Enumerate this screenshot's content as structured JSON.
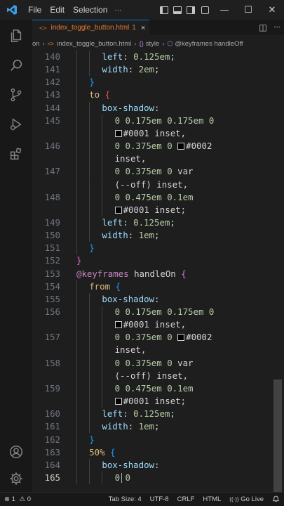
{
  "titlebar": {
    "menu": [
      "File",
      "Edit",
      "Selection"
    ],
    "more": "···",
    "minimize": "—",
    "maximize": "☐",
    "close": "✕"
  },
  "tab": {
    "icon": "<>",
    "label": "index_toggle_button.html",
    "problem_count": "1",
    "close": "×"
  },
  "tab_actions": {
    "split": "◫",
    "more": "···"
  },
  "breadcrumb": {
    "items": [
      "on",
      "index_toggle_button.html",
      "style",
      "@keyframes handleOff"
    ],
    "sep": "›",
    "html_icon": "<>",
    "style_icon": "{}",
    "sym_icon": "⬡"
  },
  "editor": {
    "lines": [
      {
        "n": "140",
        "indent": 2,
        "tokens": [
          [
            "prop",
            "left"
          ],
          [
            "plain",
            ": "
          ],
          [
            "num",
            "0.125em"
          ],
          [
            "plain",
            ";"
          ]
        ]
      },
      {
        "n": "141",
        "indent": 2,
        "tokens": [
          [
            "prop",
            "width"
          ],
          [
            "plain",
            ": "
          ],
          [
            "num",
            "2em"
          ],
          [
            "plain",
            ";"
          ]
        ]
      },
      {
        "n": "142",
        "indent": 1,
        "tokens": [
          [
            "brace2",
            "}"
          ]
        ]
      },
      {
        "n": "143",
        "indent": 1,
        "tokens": [
          [
            "sel",
            "to"
          ],
          [
            "plain",
            " "
          ],
          [
            "err",
            "{"
          ]
        ]
      },
      {
        "n": "144",
        "indent": 2,
        "tokens": [
          [
            "prop",
            "box-shadow"
          ],
          [
            "plain",
            ":"
          ]
        ]
      },
      {
        "n": "145",
        "indent": 3,
        "tokens": [
          [
            "num",
            "0 0.175em 0.175em 0"
          ]
        ]
      },
      {
        "n": "",
        "indent": 3,
        "tokens": [
          [
            "swatch",
            ""
          ],
          [
            "plain",
            "#0001 inset,"
          ]
        ]
      },
      {
        "n": "146",
        "indent": 3,
        "tokens": [
          [
            "num",
            "0 0.375em 0 "
          ],
          [
            "swatch",
            ""
          ],
          [
            "plain",
            "#0002"
          ]
        ]
      },
      {
        "n": "",
        "indent": 3,
        "tokens": [
          [
            "plain",
            "inset,"
          ]
        ]
      },
      {
        "n": "147",
        "indent": 3,
        "tokens": [
          [
            "num",
            "0 0.375em 0 "
          ],
          [
            "plain",
            "var"
          ]
        ]
      },
      {
        "n": "",
        "indent": 3,
        "tokens": [
          [
            "plain",
            "(--off) inset,"
          ]
        ]
      },
      {
        "n": "148",
        "indent": 3,
        "tokens": [
          [
            "num",
            "0 0.475em 0.1em"
          ]
        ]
      },
      {
        "n": "",
        "indent": 3,
        "tokens": [
          [
            "swatch",
            ""
          ],
          [
            "plain",
            "#0001 inset;"
          ]
        ]
      },
      {
        "n": "149",
        "indent": 2,
        "tokens": [
          [
            "prop",
            "left"
          ],
          [
            "plain",
            ": "
          ],
          [
            "num",
            "0.125em"
          ],
          [
            "plain",
            ";"
          ]
        ]
      },
      {
        "n": "150",
        "indent": 2,
        "tokens": [
          [
            "prop",
            "width"
          ],
          [
            "plain",
            ": "
          ],
          [
            "num",
            "1em"
          ],
          [
            "plain",
            ";"
          ]
        ]
      },
      {
        "n": "151",
        "indent": 1,
        "tokens": [
          [
            "brace2",
            "}"
          ]
        ]
      },
      {
        "n": "152",
        "indent": 0,
        "tokens": [
          [
            "brace1",
            "}"
          ]
        ]
      },
      {
        "n": "153",
        "indent": 0,
        "tokens": [
          [
            "kw",
            "@keyframes"
          ],
          [
            "plain",
            " handleOn "
          ],
          [
            "brace1",
            "{"
          ]
        ]
      },
      {
        "n": "154",
        "indent": 1,
        "tokens": [
          [
            "sel",
            "from"
          ],
          [
            "plain",
            " "
          ],
          [
            "brace2",
            "{"
          ]
        ]
      },
      {
        "n": "155",
        "indent": 2,
        "tokens": [
          [
            "prop",
            "box-shadow"
          ],
          [
            "plain",
            ":"
          ]
        ]
      },
      {
        "n": "156",
        "indent": 3,
        "tokens": [
          [
            "num",
            "0 0.175em 0.175em 0"
          ]
        ]
      },
      {
        "n": "",
        "indent": 3,
        "tokens": [
          [
            "swatch",
            ""
          ],
          [
            "plain",
            "#0001 inset,"
          ]
        ]
      },
      {
        "n": "157",
        "indent": 3,
        "tokens": [
          [
            "num",
            "0 0.375em 0 "
          ],
          [
            "swatch",
            ""
          ],
          [
            "plain",
            "#0002"
          ]
        ]
      },
      {
        "n": "",
        "indent": 3,
        "tokens": [
          [
            "plain",
            "inset,"
          ]
        ]
      },
      {
        "n": "158",
        "indent": 3,
        "tokens": [
          [
            "num",
            "0 0.375em 0 "
          ],
          [
            "plain",
            "var"
          ]
        ]
      },
      {
        "n": "",
        "indent": 3,
        "tokens": [
          [
            "plain",
            "(--off) inset,"
          ]
        ]
      },
      {
        "n": "159",
        "indent": 3,
        "tokens": [
          [
            "num",
            "0 0.475em 0.1em"
          ]
        ]
      },
      {
        "n": "",
        "indent": 3,
        "tokens": [
          [
            "swatch",
            ""
          ],
          [
            "plain",
            "#0001 inset;"
          ]
        ]
      },
      {
        "n": "160",
        "indent": 2,
        "tokens": [
          [
            "prop",
            "left"
          ],
          [
            "plain",
            ": "
          ],
          [
            "num",
            "0.125em"
          ],
          [
            "plain",
            ";"
          ]
        ]
      },
      {
        "n": "161",
        "indent": 2,
        "tokens": [
          [
            "prop",
            "width"
          ],
          [
            "plain",
            ": "
          ],
          [
            "num",
            "1em"
          ],
          [
            "plain",
            ";"
          ]
        ]
      },
      {
        "n": "162",
        "indent": 1,
        "tokens": [
          [
            "brace2",
            "}"
          ]
        ]
      },
      {
        "n": "163",
        "indent": 1,
        "tokens": [
          [
            "sel",
            "50%"
          ],
          [
            "plain",
            " "
          ],
          [
            "brace2",
            "{"
          ]
        ]
      },
      {
        "n": "164",
        "indent": 2,
        "tokens": [
          [
            "prop",
            "box-shadow"
          ],
          [
            "plain",
            ":"
          ]
        ]
      },
      {
        "n": "165",
        "indent": 3,
        "current": true,
        "tokens": [
          [
            "num",
            "0 0"
          ]
        ]
      }
    ]
  },
  "statusbar": {
    "remote_icon": "⊗",
    "problems": "1",
    "warnings_icon": "⚠",
    "warnings": "0",
    "tab_size": "Tab Size: 4",
    "encoding": "UTF-8",
    "eol": "CRLF",
    "language": "HTML",
    "go_live": "Go Live",
    "go_live_icon": "((·))"
  },
  "colors": {
    "accent": "#0078d4",
    "editor_bg": "#1e1e1e",
    "modified_tab": "#e37933",
    "error": "#f14c4c"
  }
}
